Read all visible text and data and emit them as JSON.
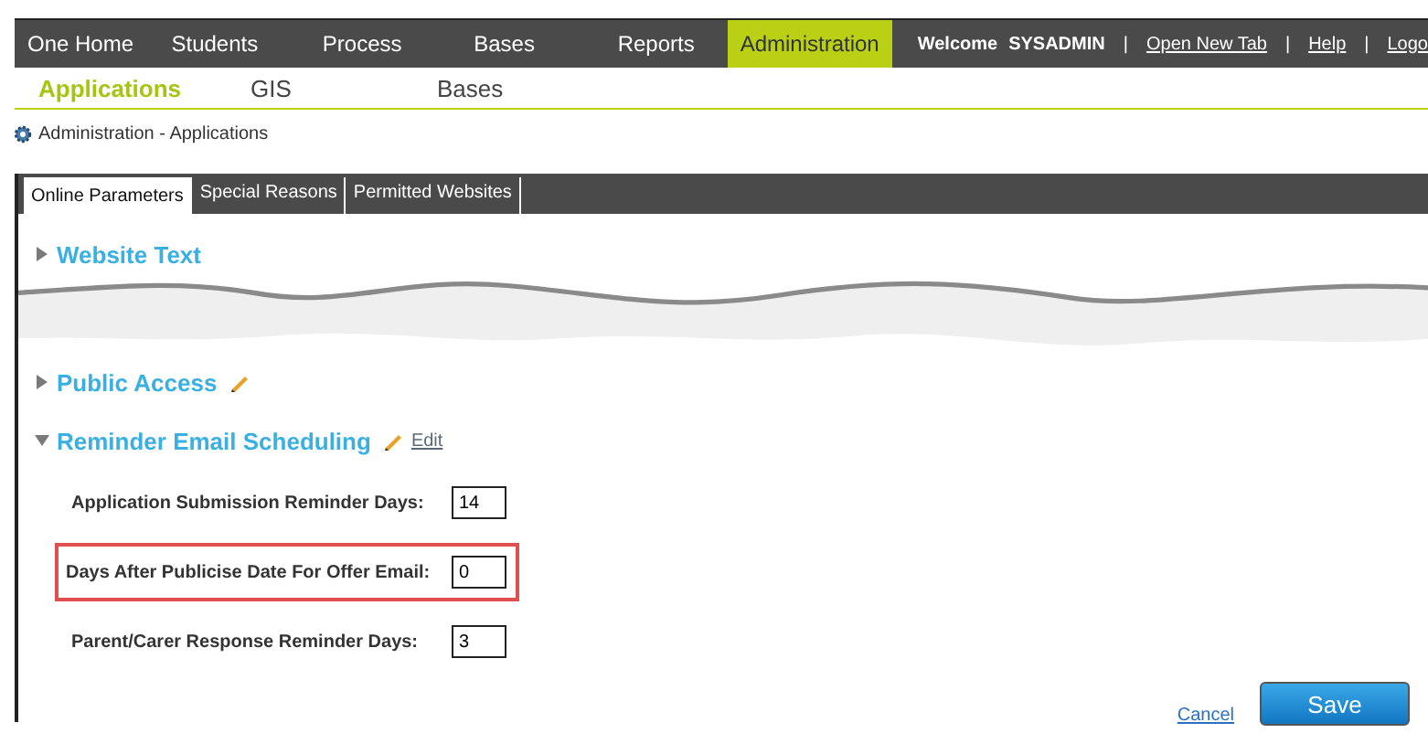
{
  "top_nav": {
    "items": [
      {
        "label": "One Home",
        "selected": false
      },
      {
        "label": "Students",
        "selected": false
      },
      {
        "label": "Process",
        "selected": false
      },
      {
        "label": "Bases",
        "selected": false
      },
      {
        "label": "Reports",
        "selected": false
      },
      {
        "label": "Administration",
        "selected": true
      }
    ],
    "welcome": "Welcome",
    "user": "SYSADMIN",
    "separator": "|",
    "links": [
      "Open New Tab",
      "Help",
      "Logo"
    ]
  },
  "sub_nav": [
    {
      "label": "Applications",
      "selected": true
    },
    {
      "label": "GIS",
      "selected": false
    },
    {
      "label": "Bases",
      "selected": false
    }
  ],
  "breadcrumb": "Administration - Applications",
  "tabs": [
    {
      "label": "Online Parameters",
      "selected": true
    },
    {
      "label": "Special Reasons",
      "selected": false
    },
    {
      "label": "Permitted Websites",
      "selected": false
    }
  ],
  "sections": [
    {
      "title": "Website Text",
      "expanded": false,
      "editable": false
    },
    {
      "title": "Public Access",
      "expanded": false,
      "editable": true
    },
    {
      "title": "Reminder Email Scheduling",
      "expanded": true,
      "editable": true,
      "edit_label": "Edit",
      "fields": [
        {
          "label": "Application Submission Reminder Days:",
          "value": "14",
          "highlighted": false
        },
        {
          "label": "Days After Publicise Date For Offer Email:",
          "value": "0",
          "highlighted": true
        },
        {
          "label": "Parent/Carer Response Reminder Days:",
          "value": "3",
          "highlighted": false
        }
      ]
    }
  ],
  "actions": {
    "cancel": "Cancel",
    "save": "Save"
  }
}
